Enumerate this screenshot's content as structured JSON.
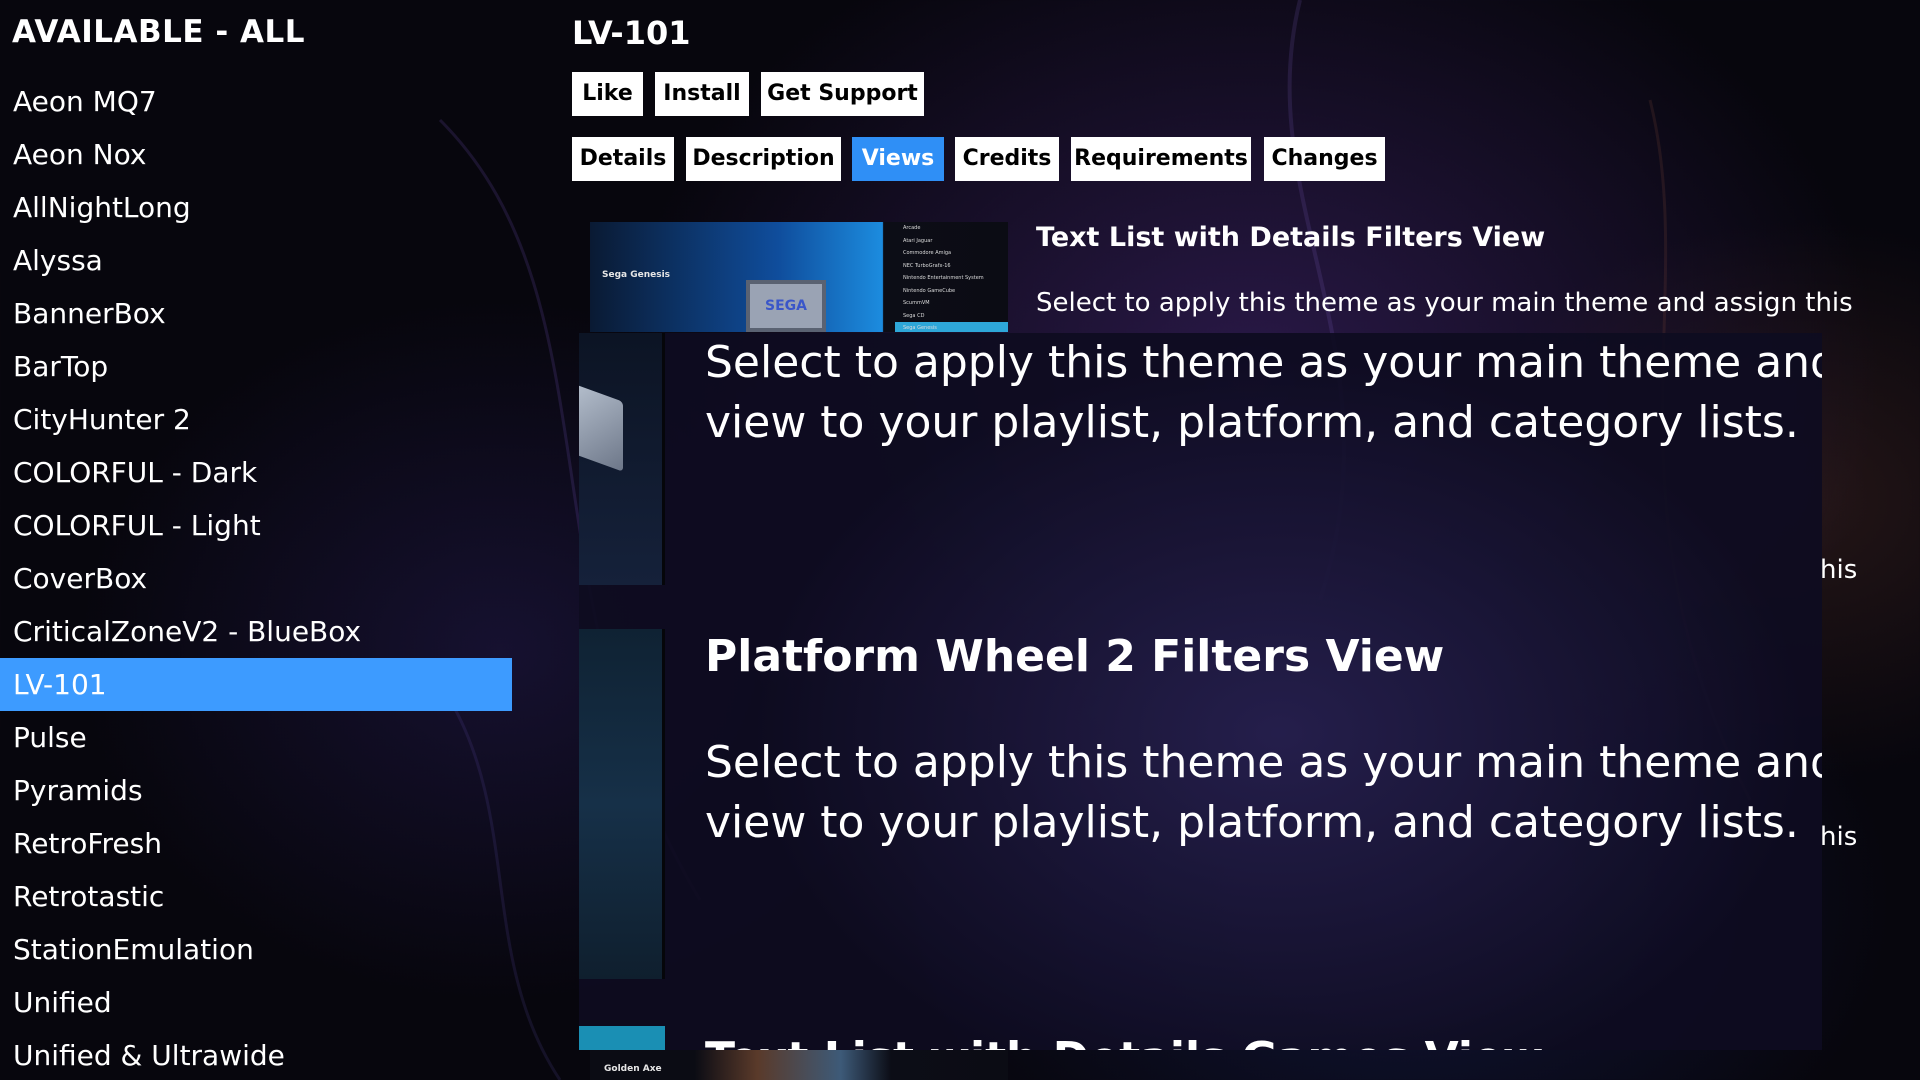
{
  "sidebar": {
    "title": "AVAILABLE - ALL",
    "items": [
      {
        "label": "Aeon MQ7"
      },
      {
        "label": "Aeon Nox"
      },
      {
        "label": "AllNightLong"
      },
      {
        "label": "Alyssa"
      },
      {
        "label": "BannerBox"
      },
      {
        "label": "BarTop"
      },
      {
        "label": "CityHunter 2"
      },
      {
        "label": "COLORFUL - Dark"
      },
      {
        "label": "COLORFUL - Light"
      },
      {
        "label": "CoverBox"
      },
      {
        "label": "CriticalZoneV2 - BlueBox"
      },
      {
        "label": "LV-101",
        "selected": true
      },
      {
        "label": "Pulse"
      },
      {
        "label": "Pyramids"
      },
      {
        "label": "RetroFresh"
      },
      {
        "label": "Retrotastic"
      },
      {
        "label": "StationEmulation"
      },
      {
        "label": "Unified"
      },
      {
        "label": "Unified & Ultrawide"
      }
    ]
  },
  "detail": {
    "title": "LV-101",
    "actions": {
      "like": "Like",
      "install": "Install",
      "support": "Get Support"
    },
    "tabs": {
      "details": "Details",
      "description": "Description",
      "views": "Views",
      "credits": "Credits",
      "requirements": "Requirements",
      "changes": "Changes",
      "active": "Views"
    }
  },
  "views": [
    {
      "name": "Text List with Details Filters View",
      "description": "Select to apply this theme as your main theme and assign this view to your playlist, platform, and category lists."
    },
    {
      "name": "Platform Wheel 2 Filters View",
      "description": "Select to apply this theme as your main theme and assign this view to your playlist, platform, and category lists."
    },
    {
      "name": "Text List with Details Games View"
    }
  ],
  "magnifier": {
    "line1": "Select to apply this theme as your main theme and assi",
    "line2": "view to your playlist, platform, and category lists.",
    "line3": "Select to apply this theme as your main theme and assi",
    "line4": "view to your playlist, platform, and category lists.",
    "partial_title": "Text List with Details Games View"
  },
  "peek_fragments": {
    "a": "his",
    "b": "his"
  },
  "thumbnails": {
    "first": {
      "caption": "Sega Genesis",
      "console_label": "SEGA",
      "menu": [
        "Arcade",
        "Atari Jaguar",
        "Commodore Amiga",
        "NEC TurboGrafx-16",
        "Nintendo Entertainment System",
        "Nintendo GameCube",
        "ScummVM",
        "Sega CD",
        "Sega Genesis"
      ],
      "menu_highlight": "Sega Genesis"
    },
    "bottom": {
      "caption": "Golden Axe"
    }
  },
  "colors": {
    "accent": "#3d9bff",
    "active_tab": "#2f8ff6",
    "button_bg": "#ffffff",
    "background": "#07060d"
  }
}
